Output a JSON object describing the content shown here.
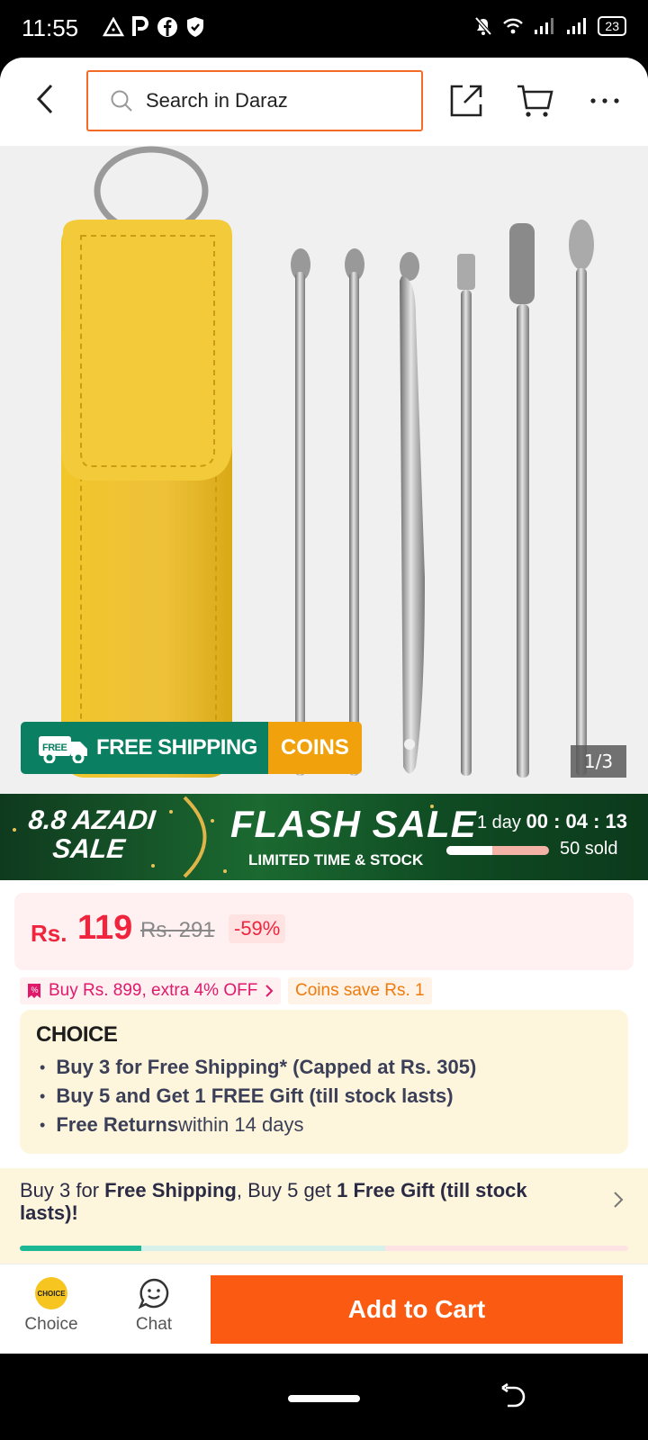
{
  "status_bar": {
    "time": "11:55",
    "battery": "23",
    "left_icons": [
      "alert-icon",
      "parking-icon",
      "facebook-icon",
      "shield-icon"
    ],
    "right_icons": [
      "mute-icon",
      "wifi-icon",
      "signal-icon",
      "signal-icon"
    ]
  },
  "header": {
    "search_placeholder": "Search in Daraz",
    "accent_color": "#f36b25"
  },
  "gallery": {
    "counter": "1/3",
    "badge_free_shipping": "FREE SHIPPING",
    "badge_free_tag": "FREE",
    "badge_coins": "COINS"
  },
  "flash_sale": {
    "campaign_line1": "8.8 AZADI",
    "campaign_line2": "SALE",
    "title": "FLASH SALE",
    "subtitle": "LIMITED TIME & STOCK",
    "timer_days": "1 day",
    "timer_clock": "00 : 04 : 13",
    "sold_text": "50 sold",
    "sold_progress": 0.45
  },
  "price": {
    "currency": "Rs.",
    "current": "119",
    "original": "Rs. 291",
    "discount": "-59%",
    "color": "#f0243d"
  },
  "promos": {
    "voucher": "Buy Rs. 899, extra 4% OFF",
    "coins": "Coins save Rs. 1"
  },
  "choice": {
    "logo": "CHOICE",
    "items": [
      {
        "bold": "Buy 3 for  Free Shipping* (Capped at Rs. 305)",
        "rest": ""
      },
      {
        "bold": "Buy 5 and Get 1 FREE Gift (till stock lasts)",
        "rest": ""
      },
      {
        "bold": "Free Returns",
        "rest": " within 14 days"
      }
    ]
  },
  "bundle": {
    "t1": "Buy 3 for ",
    "t2": "Free Shipping",
    "t3": ", Buy 5 get ",
    "t4": "1 Free Gift (till stock lasts)!",
    "progress": 0.2
  },
  "bottom_bar": {
    "choice_label": "Choice",
    "choice_icon_text": "CHOICE",
    "chat_label": "Chat",
    "add_to_cart": "Add to Cart",
    "button_color": "#fb5a13"
  }
}
